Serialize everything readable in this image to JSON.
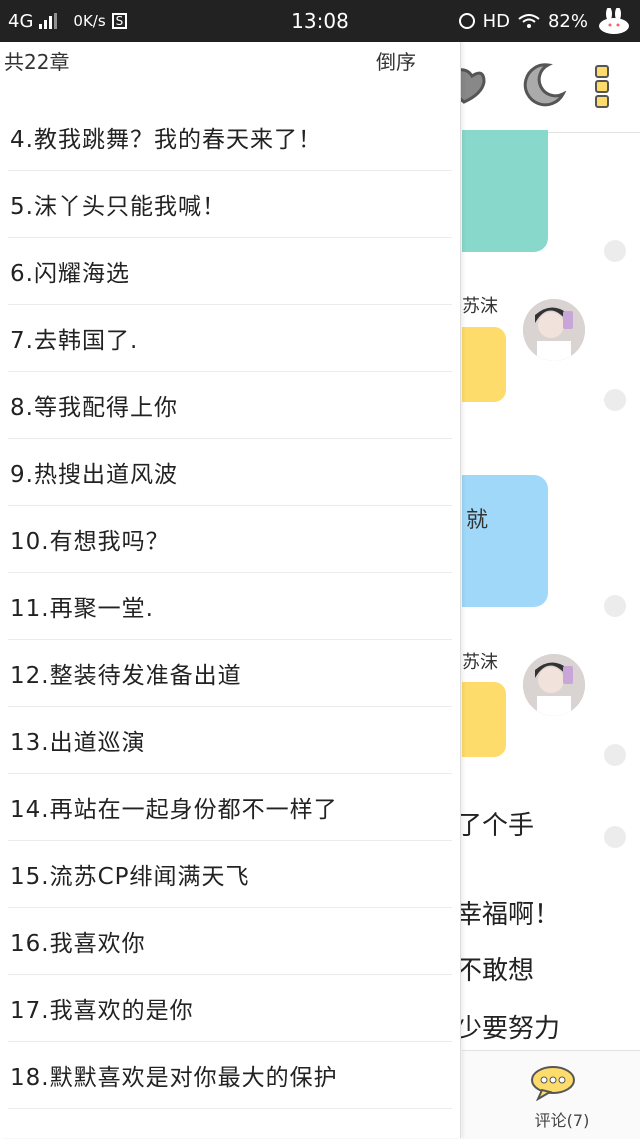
{
  "status_bar": {
    "network": "4G",
    "speed": "0K/s",
    "s_badge": "S",
    "time": "13:08",
    "hd": "HD",
    "battery": "82%"
  },
  "drawer": {
    "count_label": "共22章",
    "sort_label": "倒序",
    "chapters": [
      "4.教我跳舞？我的春天来了！",
      "5.沫丫头只能我喊！",
      "6.闪耀海选",
      "7.去韩国了.",
      "8.等我配得上你",
      "9.热搜出道风波",
      "10.有想我吗？",
      "11.再聚一堂.",
      "12.整装待发准备出道",
      "13.出道巡演",
      "14.再站在一起身份都不一样了",
      "15.流苏CP绯闻满天飞",
      "16.我喜欢你",
      "17.我喜欢的是你",
      "18.默默喜欢是对你最大的保护"
    ]
  },
  "reader": {
    "name_1": "苏沫",
    "name_2": "苏沫",
    "blue_text": "就",
    "text_lines": [
      "了个手",
      "幸福啊！",
      "不敢想",
      "少要努力"
    ],
    "comment_label": "评论(7)",
    "colors": {
      "green_bubble": "#89d8cc",
      "yellow_bubble": "#fedc6b",
      "blue_bubble": "#9fd8f8"
    }
  }
}
